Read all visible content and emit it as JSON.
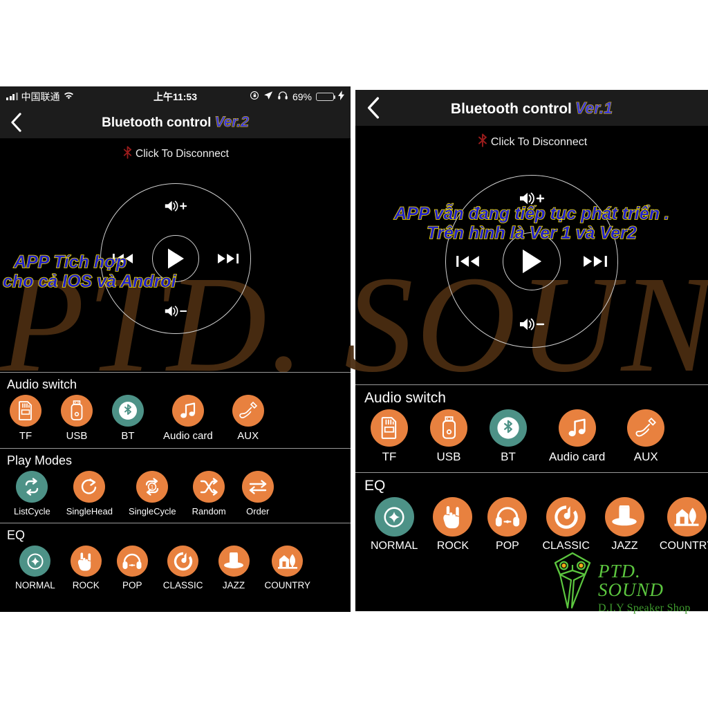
{
  "colors": {
    "accent_orange": "#e8813f",
    "selected_teal": "#4d9287",
    "app_background": "#000000",
    "navbar": "#1c1c1c",
    "overlay_text": "#2222c8",
    "overlay_outline": "#ffe800",
    "battery_green": "#4cd964",
    "logo_green": "#5cc63f",
    "watermark_brown": "#4a2d11"
  },
  "watermark": {
    "text": "PTD. SOUND"
  },
  "logo": {
    "icon": "owl-icon",
    "title": "PTD. SOUND",
    "subtitle": "D.I.Y Speaker Shop"
  },
  "left_panel": {
    "statusbar": {
      "signal": "signal-bars-icon",
      "carrier": "中国联通",
      "wifi": "wifi-icon",
      "time": "上午11:53",
      "rotation_lock": "rotation-lock-icon",
      "location": "location-arrow-icon",
      "headphones": "headphones-icon",
      "battery_percent": "69%",
      "battery": "battery-icon",
      "charging": "lightning-bolt-icon"
    },
    "navbar": {
      "back": "chevron-left-icon",
      "title": "Bluetooth control",
      "version": "Ver.2"
    },
    "disconnect": {
      "icon": "bluetooth-off-icon",
      "label": "Click To Disconnect"
    },
    "overlay": {
      "line1": "APP Tích hợp",
      "line2": "cho cả IOS và Androi"
    },
    "player": {
      "volume_up": "volume-up-icon",
      "volume_down": "volume-down-icon",
      "previous": "previous-track-icon",
      "next": "next-track-icon",
      "play": "play-icon"
    },
    "sections": [
      {
        "title": "Audio switch",
        "name": "audio-switch",
        "items": [
          {
            "label": "TF",
            "icon": "sd-card-icon",
            "selected": false
          },
          {
            "label": "USB",
            "icon": "usb-drive-icon",
            "selected": false
          },
          {
            "label": "BT",
            "icon": "bluetooth-icon",
            "selected": true
          },
          {
            "label": "Audio card",
            "icon": "music-note-icon",
            "selected": false
          },
          {
            "label": "AUX",
            "icon": "aux-cable-icon",
            "selected": false
          }
        ]
      },
      {
        "title": "Play Modes",
        "name": "play-modes",
        "items": [
          {
            "label": "ListCycle",
            "icon": "repeat-list-icon",
            "selected": true
          },
          {
            "label": "SingleHead",
            "icon": "repeat-once-icon",
            "selected": false
          },
          {
            "label": "SingleCycle",
            "icon": "repeat-one-icon",
            "selected": false
          },
          {
            "label": "Random",
            "icon": "shuffle-icon",
            "selected": false
          },
          {
            "label": "Order",
            "icon": "order-arrows-icon",
            "selected": false
          }
        ]
      },
      {
        "title": "EQ",
        "name": "eq",
        "items": [
          {
            "label": "NORMAL",
            "icon": "normal-diamond-icon",
            "selected": true
          },
          {
            "label": "ROCK",
            "icon": "rock-hand-icon",
            "selected": false
          },
          {
            "label": "POP",
            "icon": "headphones-icon",
            "selected": false
          },
          {
            "label": "CLASSIC",
            "icon": "classic-note-icon",
            "selected": false
          },
          {
            "label": "JAZZ",
            "icon": "top-hat-icon",
            "selected": false
          },
          {
            "label": "COUNTRY",
            "icon": "country-barn-icon",
            "selected": false
          }
        ]
      }
    ]
  },
  "right_panel": {
    "navbar": {
      "back": "chevron-left-icon",
      "title": "Bluetooth control",
      "version": "Ver.1"
    },
    "disconnect": {
      "icon": "bluetooth-off-icon",
      "label": "Click To Disconnect"
    },
    "overlay": {
      "line1": "APP vẫn đang tiếp tục phát triển .",
      "line2": "Trên hình là Ver 1 và Ver2"
    },
    "player": {
      "volume_up": "volume-up-icon",
      "volume_down": "volume-down-icon",
      "previous": "previous-track-icon",
      "next": "next-track-icon",
      "play": "play-icon"
    },
    "sections": [
      {
        "title": "Audio switch",
        "name": "audio-switch",
        "items": [
          {
            "label": "TF",
            "icon": "sd-card-icon",
            "selected": false
          },
          {
            "label": "USB",
            "icon": "usb-drive-icon",
            "selected": false
          },
          {
            "label": "BT",
            "icon": "bluetooth-icon",
            "selected": true
          },
          {
            "label": "Audio card",
            "icon": "music-note-icon",
            "selected": false
          },
          {
            "label": "AUX",
            "icon": "aux-cable-icon",
            "selected": false
          }
        ]
      },
      {
        "title": "EQ",
        "name": "eq",
        "items": [
          {
            "label": "NORMAL",
            "icon": "normal-diamond-icon",
            "selected": true
          },
          {
            "label": "ROCK",
            "icon": "rock-hand-icon",
            "selected": false
          },
          {
            "label": "POP",
            "icon": "headphones-icon",
            "selected": false
          },
          {
            "label": "CLASSIC",
            "icon": "classic-note-icon",
            "selected": false
          },
          {
            "label": "JAZZ",
            "icon": "top-hat-icon",
            "selected": false
          },
          {
            "label": "COUNTRY",
            "icon": "country-barn-icon",
            "selected": false
          }
        ]
      }
    ]
  }
}
